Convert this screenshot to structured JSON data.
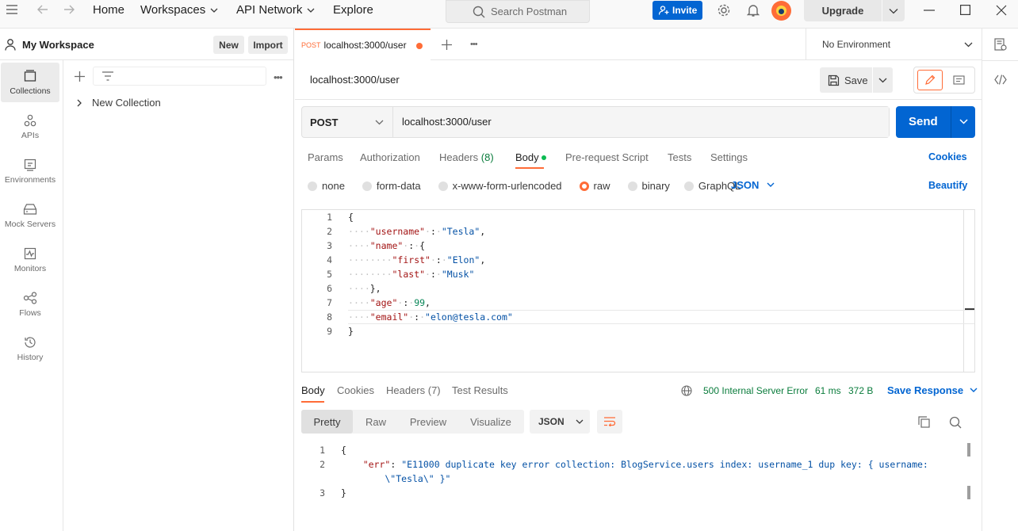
{
  "topbar": {
    "nav": [
      {
        "label": "Home"
      },
      {
        "label": "Workspaces"
      },
      {
        "label": "API Network"
      },
      {
        "label": "Explore"
      }
    ],
    "search_placeholder": "Search Postman",
    "invite_label": "Invite",
    "upgrade_label": "Upgrade"
  },
  "workspace": {
    "title": "My Workspace",
    "new_label": "New",
    "import_label": "Import"
  },
  "rail": [
    {
      "label": "Collections",
      "icon": "collections-icon"
    },
    {
      "label": "APIs",
      "icon": "apis-icon"
    },
    {
      "label": "Environments",
      "icon": "environments-icon"
    },
    {
      "label": "Mock Servers",
      "icon": "mock-servers-icon"
    },
    {
      "label": "Monitors",
      "icon": "monitors-icon"
    },
    {
      "label": "Flows",
      "icon": "flows-icon"
    },
    {
      "label": "History",
      "icon": "history-icon"
    }
  ],
  "collections": [
    {
      "name": "New Collection"
    }
  ],
  "request_tab": {
    "method": "POST",
    "title": "localhost:3000/user"
  },
  "environment": "No Environment",
  "request": {
    "name": "localhost:3000/user",
    "save_label": "Save",
    "method": "POST",
    "url": "localhost:3000/user",
    "send_label": "Send",
    "tabs": [
      "Params",
      "Authorization",
      "Headers",
      "Body",
      "Pre-request Script",
      "Tests",
      "Settings"
    ],
    "headers_count": "(8)",
    "cookies_label": "Cookies",
    "body_types": [
      "none",
      "form-data",
      "x-www-form-urlencoded",
      "raw",
      "binary",
      "GraphQL"
    ],
    "format": "JSON",
    "beautify_label": "Beautify",
    "body_lines": [
      "{",
      "····\"username\"·:·\"Tesla\",",
      "····\"name\"·:·{",
      "········\"first\"·:·\"Elon\",",
      "········\"last\"·:·\"Musk\"",
      "····},",
      "····\"age\"·:·99,",
      "····\"email\"·:·\"elon@tesla.com\"",
      "}"
    ]
  },
  "response": {
    "tabs": [
      "Body",
      "Cookies",
      "Headers (7)",
      "Test Results"
    ],
    "status": "500 Internal Server Error",
    "time": "61 ms",
    "size": "372 B",
    "save_label": "Save Response",
    "views": [
      "Pretty",
      "Raw",
      "Preview",
      "Visualize"
    ],
    "format": "JSON",
    "lines": [
      {
        "n": "1",
        "text": "{"
      },
      {
        "n": "2",
        "text": "    \"err\": \"E11000 duplicate key error collection: BlogService.users index: username_1 dup key: { username:"
      },
      {
        "n": "",
        "text": "        \\\"Tesla\\\" }\""
      },
      {
        "n": "3",
        "text": "}"
      }
    ]
  },
  "colors": {
    "accent": "#ff6c37",
    "primary": "#0265d2",
    "status_error": "#0a7c3c"
  }
}
